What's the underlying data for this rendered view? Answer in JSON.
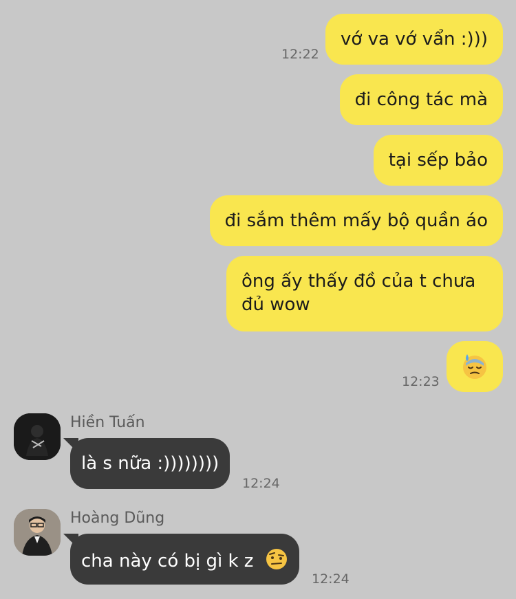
{
  "messages_out": [
    {
      "text": "vớ va vớ vẩn :)))",
      "time": "12:22"
    },
    {
      "text": "đi công tác mà"
    },
    {
      "text": "tại sếp bảo"
    },
    {
      "text": "đi sắm thêm mấy bộ quần áo"
    },
    {
      "text_line1": "ông ấy thấy đồ của t chưa",
      "text_line2": "đủ wow"
    },
    {
      "emoji": "downcast-face-with-sweat",
      "time": "12:23"
    }
  ],
  "messages_in": [
    {
      "sender": "Hiền Tuấn",
      "avatar": "avatar-hien-tuan",
      "text": "là s nữa :))))))))",
      "time": "12:24"
    },
    {
      "sender": "Hoàng Dũng",
      "avatar": "avatar-hoang-dung",
      "text": "cha này có bị gì k z",
      "emoji": "face-with-raised-eyebrow",
      "time": "12:24"
    }
  ],
  "colors": {
    "background": "#c8c8c8",
    "outgoing_bubble": "#f9e64f",
    "incoming_bubble": "#3a3a3a"
  }
}
